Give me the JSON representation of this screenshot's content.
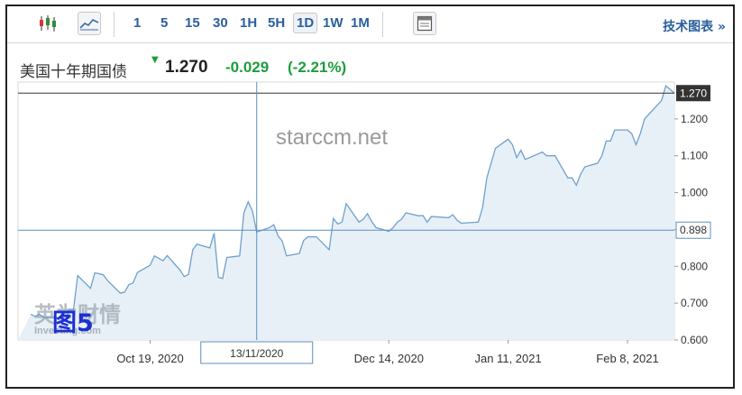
{
  "toolbar": {
    "candlestick_icon": "candlestick-icon",
    "line_chart_icon": "line-chart-icon",
    "periods": [
      "1",
      "5",
      "15",
      "30",
      "1H",
      "5H",
      "1D",
      "1W",
      "1M"
    ],
    "active_period": "1D",
    "settings_icon": "chart-settings-icon",
    "advanced_chart_label": "技术图表 »"
  },
  "quote": {
    "name": "美国十年期国债",
    "direction_icon": "triangle-down-icon",
    "price": "1.270",
    "change": "-0.029",
    "change_percent": "(-2.21%)"
  },
  "watermark": "starccm.net",
  "logo_text": "英为财情",
  "logo_subtext": "Investing.com",
  "figure_label": "图5",
  "crosshair": {
    "date_label": "13/11/2020",
    "value_label": "0.898"
  },
  "colors": {
    "line": "#6ea0cc",
    "fill": "#e8f0f7",
    "positive": "#1a9e3c",
    "link": "#2a5f9e",
    "crosshair": "#5a8fc2"
  },
  "chart_data": {
    "type": "area",
    "title": "",
    "xlabel": "",
    "ylabel": "",
    "ylim": [
      0.6,
      1.3
    ],
    "y_ticks": [
      "0.600",
      "0.700",
      "0.800",
      "0.900",
      "1.000",
      "1.100",
      "1.200"
    ],
    "x_ticks": [
      "Oct 19, 2020",
      "Dec 14, 2020",
      "Jan 11, 2021",
      "Feb 8, 2021"
    ],
    "last_value_label": "1.270",
    "series": [
      {
        "x": [
          "2020-09-21",
          "2020-09-22",
          "2020-09-23",
          "2020-09-24",
          "2020-09-25",
          "2020-09-28",
          "2020-09-29",
          "2020-09-30",
          "2020-10-01",
          "2020-10-02",
          "2020-10-05",
          "2020-10-06",
          "2020-10-07",
          "2020-10-08",
          "2020-10-09",
          "2020-10-12",
          "2020-10-13",
          "2020-10-14",
          "2020-10-15",
          "2020-10-16",
          "2020-10-19",
          "2020-10-20",
          "2020-10-21",
          "2020-10-22",
          "2020-10-23",
          "2020-10-26",
          "2020-10-27",
          "2020-10-28",
          "2020-10-29",
          "2020-10-30",
          "2020-11-02",
          "2020-11-03",
          "2020-11-04",
          "2020-11-05",
          "2020-11-06",
          "2020-11-09",
          "2020-11-10",
          "2020-11-11",
          "2020-11-12",
          "2020-11-13",
          "2020-11-16",
          "2020-11-17",
          "2020-11-18",
          "2020-11-19",
          "2020-11-20",
          "2020-11-23",
          "2020-11-24",
          "2020-11-25",
          "2020-11-27",
          "2020-11-30",
          "2020-12-01",
          "2020-12-02",
          "2020-12-03",
          "2020-12-04",
          "2020-12-07",
          "2020-12-08",
          "2020-12-09",
          "2020-12-10",
          "2020-12-11",
          "2020-12-14",
          "2020-12-15",
          "2020-12-16",
          "2020-12-17",
          "2020-12-18",
          "2020-12-21",
          "2020-12-22",
          "2020-12-23",
          "2020-12-24",
          "2020-12-28",
          "2020-12-29",
          "2020-12-30",
          "2020-12-31",
          "2021-01-04",
          "2021-01-05",
          "2021-01-06",
          "2021-01-07",
          "2021-01-08",
          "2021-01-11",
          "2021-01-12",
          "2021-01-13",
          "2021-01-14",
          "2021-01-15",
          "2021-01-19",
          "2021-01-20",
          "2021-01-21",
          "2021-01-22",
          "2021-01-25",
          "2021-01-26",
          "2021-01-27",
          "2021-01-28",
          "2021-01-29",
          "2021-02-01",
          "2021-02-02",
          "2021-02-03",
          "2021-02-04",
          "2021-02-05",
          "2021-02-08",
          "2021-02-09",
          "2021-02-10",
          "2021-02-11",
          "2021-02-12",
          "2021-02-16",
          "2021-02-17",
          "2021-02-18",
          "2021-02-19"
        ],
        "y": [
          0.67,
          0.664,
          0.67,
          0.662,
          0.66,
          0.661,
          0.652,
          0.683,
          0.683,
          0.775,
          0.74,
          0.782,
          0.78,
          0.777,
          0.761,
          0.727,
          0.73,
          0.75,
          0.755,
          0.783,
          0.803,
          0.828,
          0.822,
          0.815,
          0.829,
          0.79,
          0.772,
          0.778,
          0.845,
          0.86,
          0.85,
          0.89,
          0.77,
          0.767,
          0.824,
          0.828,
          0.945,
          0.975,
          0.95,
          0.893,
          0.905,
          0.913,
          0.883,
          0.868,
          0.828,
          0.835,
          0.87,
          0.88,
          0.88,
          0.845,
          0.93,
          0.915,
          0.92,
          0.97,
          0.92,
          0.928,
          0.943,
          0.921,
          0.905,
          0.895,
          0.905,
          0.92,
          0.928,
          0.945,
          0.937,
          0.938,
          0.92,
          0.935,
          0.932,
          0.94,
          0.925,
          0.917,
          0.92,
          0.96,
          1.04,
          1.08,
          1.12,
          1.145,
          1.13,
          1.095,
          1.115,
          1.09,
          1.11,
          1.1,
          1.1,
          1.1,
          1.04,
          1.04,
          1.02,
          1.05,
          1.07,
          1.08,
          1.1,
          1.14,
          1.14,
          1.17,
          1.17,
          1.16,
          1.13,
          1.16,
          1.2,
          1.25,
          1.29,
          1.28,
          1.27
        ]
      }
    ]
  }
}
